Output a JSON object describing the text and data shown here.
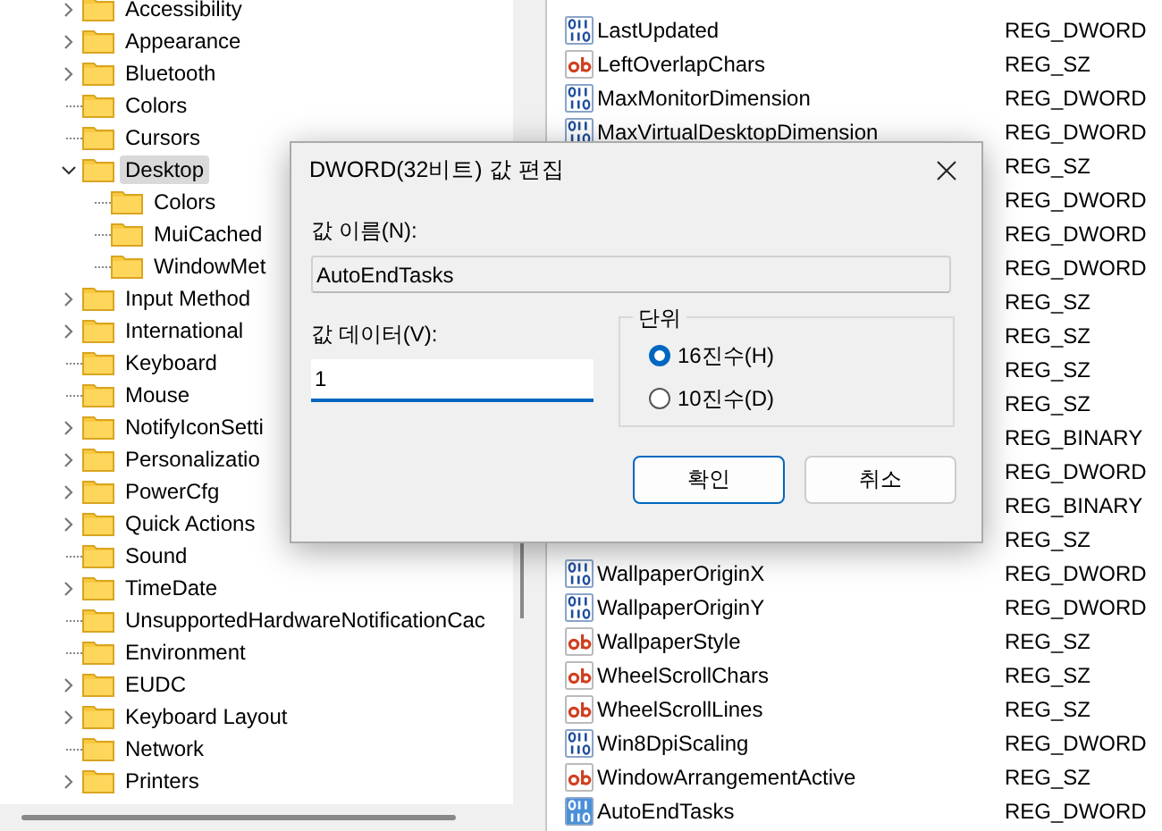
{
  "tree": {
    "items": [
      {
        "children": [
          {
            "label": "Accessibility",
            "expanded": false,
            "selected": false
          },
          {
            "label": "Appearance",
            "expanded": false,
            "selected": false
          },
          {
            "label": "Bluetooth",
            "expanded": false,
            "selected": false
          },
          {
            "label": "Colors",
            "selected": false
          },
          {
            "label": "Cursors",
            "selected": false
          },
          {
            "label": "Desktop",
            "expanded": true,
            "selected": true,
            "children": [
              {
                "label": "Colors",
                "selected": false
              },
              {
                "label": "MuiCached",
                "selected": false
              },
              {
                "label": "WindowMet",
                "selected": false
              }
            ]
          },
          {
            "label": "Input Method",
            "expanded": false,
            "selected": false
          },
          {
            "label": "International",
            "expanded": false,
            "selected": false
          },
          {
            "label": "Keyboard",
            "selected": false
          },
          {
            "label": "Mouse",
            "selected": false
          },
          {
            "label": "NotifyIconSetti",
            "expanded": false,
            "selected": false
          },
          {
            "label": "Personalizatio",
            "expanded": false,
            "selected": false
          },
          {
            "label": "PowerCfg",
            "expanded": false,
            "selected": false
          },
          {
            "label": "Quick Actions",
            "expanded": false,
            "selected": false
          },
          {
            "label": "Sound",
            "selected": false
          },
          {
            "label": "TimeDate",
            "expanded": false,
            "selected": false
          },
          {
            "label": "UnsupportedHardwareNotificationCac",
            "selected": false
          }
        ]
      },
      {
        "label": "Environment",
        "selected": false
      },
      {
        "label": "EUDC",
        "expanded": false,
        "selected": false
      },
      {
        "label": "Keyboard Layout",
        "expanded": false,
        "selected": false
      },
      {
        "label": "Network",
        "selected": false
      },
      {
        "label": "Printers",
        "expanded": false,
        "selected": false
      }
    ]
  },
  "values": {
    "rows": [
      {
        "name": "LastUpdated",
        "type": "REG_DWORD",
        "kind": "number",
        "selected": false
      },
      {
        "name": "LeftOverlapChars",
        "type": "REG_SZ",
        "kind": "string",
        "selected": false
      },
      {
        "name": "MaxMonitorDimension",
        "type": "REG_DWORD",
        "kind": "number",
        "selected": false
      },
      {
        "name": "MaxVirtualDesktopDimension",
        "type": "REG_DWORD",
        "kind": "number",
        "selected": false
      },
      {
        "type": "REG_SZ"
      },
      {
        "type": "REG_DWORD"
      },
      {
        "type": "REG_DWORD"
      },
      {
        "type": "REG_DWORD"
      },
      {
        "type": "REG_SZ"
      },
      {
        "type": "REG_SZ"
      },
      {
        "type": "REG_SZ"
      },
      {
        "type": "REG_SZ"
      },
      {
        "type": "REG_BINARY"
      },
      {
        "type": "REG_DWORD"
      },
      {
        "type": "REG_BINARY"
      },
      {
        "type": "REG_SZ"
      },
      {
        "name": "WallpaperOriginX",
        "type": "REG_DWORD",
        "kind": "number",
        "selected": false
      },
      {
        "name": "WallpaperOriginY",
        "type": "REG_DWORD",
        "kind": "number",
        "selected": false
      },
      {
        "name": "WallpaperStyle",
        "type": "REG_SZ",
        "kind": "string",
        "selected": false
      },
      {
        "name": "WheelScrollChars",
        "type": "REG_SZ",
        "kind": "string",
        "selected": false
      },
      {
        "name": "WheelScrollLines",
        "type": "REG_SZ",
        "kind": "string",
        "selected": false
      },
      {
        "name": "Win8DpiScaling",
        "type": "REG_DWORD",
        "kind": "number",
        "selected": false
      },
      {
        "name": "WindowArrangementActive",
        "type": "REG_SZ",
        "kind": "string",
        "selected": false
      },
      {
        "name": "AutoEndTasks",
        "type": "REG_DWORD",
        "kind": "number",
        "selected": true
      }
    ]
  },
  "dialog": {
    "title": "DWORD(32비트) 값 편집",
    "name_label": "값 이름(N):",
    "name_value": "AutoEndTasks",
    "data_label": "값 데이터(V):",
    "data_value": "1",
    "base_group": {
      "title": "단위",
      "options": [
        {
          "label": "16진수(H)",
          "selected": true
        },
        {
          "label": "10진수(D)",
          "selected": false
        }
      ]
    },
    "buttons": [
      {
        "label": "확인",
        "default": true
      },
      {
        "label": "취소",
        "default": false
      }
    ]
  }
}
